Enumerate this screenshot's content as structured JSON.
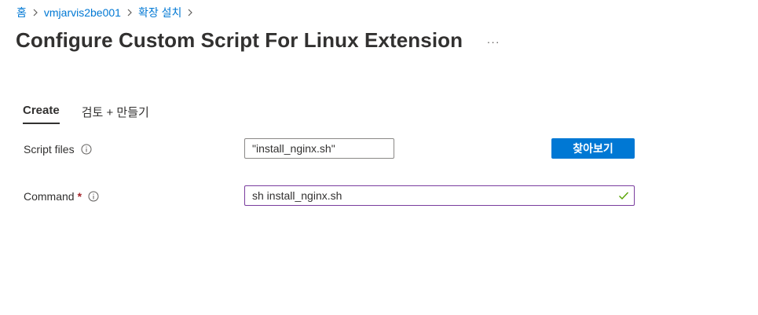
{
  "breadcrumb": {
    "items": [
      "홈",
      "vmjarvis2be001",
      "확장 설치"
    ]
  },
  "header": {
    "title": "Configure Custom Script For Linux Extension",
    "more_label": "···"
  },
  "tabs": [
    {
      "label": "Create",
      "active": true
    },
    {
      "label": "검토 + 만들기",
      "active": false
    }
  ],
  "form": {
    "script_files": {
      "label": "Script files",
      "value": "\"install_nginx.sh\"",
      "browse_label": "찾아보기"
    },
    "command": {
      "label": "Command",
      "required_mark": "*",
      "value": "sh install_nginx.sh",
      "valid": true
    }
  },
  "colors": {
    "link": "#0078d4",
    "primary_button": "#0078d4",
    "focus_border": "#7a3d9e",
    "valid_check": "#57a300",
    "required": "#a4262c"
  }
}
